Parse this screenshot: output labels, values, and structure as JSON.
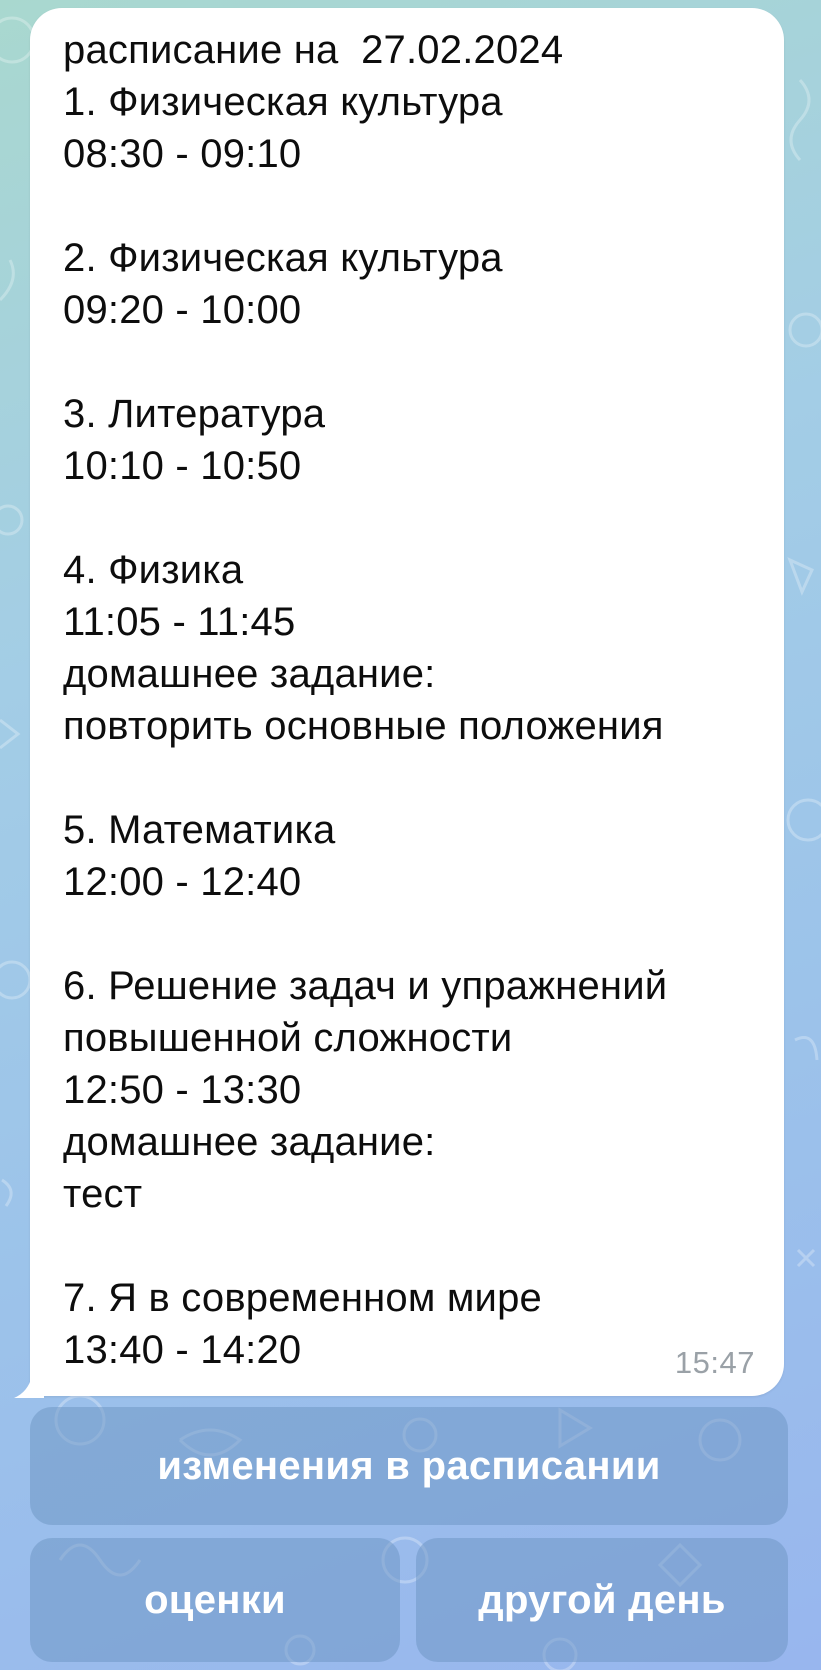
{
  "message": {
    "lines": [
      "расписание на  27.02.2024",
      "1. Физическая культура",
      "08:30 - 09:10",
      "",
      "2. Физическая культура",
      "09:20 - 10:00",
      "",
      "3. Литература",
      "10:10 - 10:50",
      "",
      "4. Физика",
      "11:05 - 11:45",
      "домашнее задание:",
      "повторить основные положения",
      "",
      "5. Математика",
      "12:00 - 12:40",
      "",
      "6. Решение задач и упражнений",
      "повышенной сложности",
      "12:50 - 13:30",
      "домашнее задание:",
      "тест",
      "",
      "7. Я в современном мире",
      "13:40 - 14:20"
    ],
    "time": "15:47"
  },
  "keyboard": {
    "changes_label": "изменения в расписании",
    "grades_label": "оценки",
    "other_day_label": "другой день"
  },
  "colors": {
    "bubble": "#ffffff",
    "button_bg": "rgba(110,150,195,0.52)",
    "button_text": "#ffffff",
    "time_text": "#9aa1a7"
  }
}
